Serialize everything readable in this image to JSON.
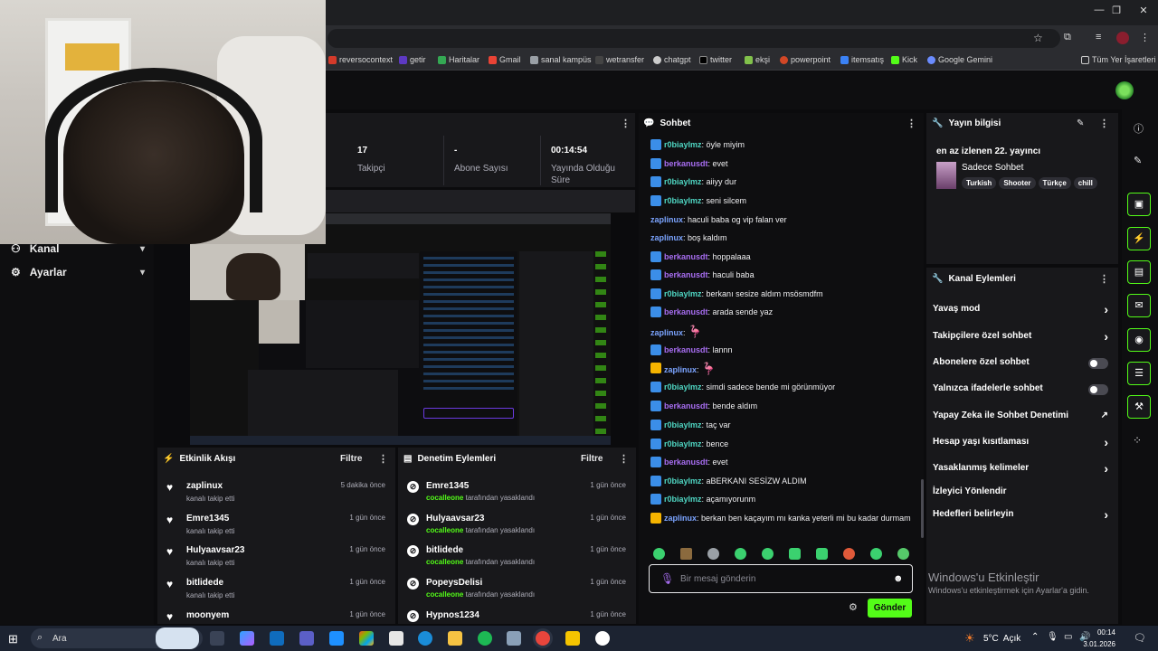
{
  "browser": {
    "window_controls": [
      "—",
      "❐",
      "✕"
    ],
    "bookmarks": [
      "reversocontext",
      "getir",
      "Haritalar",
      "Gmail",
      "sanal kampüs",
      "wetransfer",
      "chatgpt",
      "twitter",
      "ekşi",
      "powerpoint",
      "itemsatış",
      "Kick",
      "Google Gemini"
    ],
    "all_bookmarks": "Tüm Yer İşaretleri"
  },
  "sidebar": {
    "items": [
      {
        "label": "Kanal"
      },
      {
        "label": "Ayarlar"
      }
    ]
  },
  "stats": {
    "followers": {
      "value": "17",
      "label": "Takipçi"
    },
    "subs": {
      "value": "-",
      "label": "Abone Sayısı"
    },
    "uptime": {
      "value": "00:14:54",
      "label": "Yayında Olduğu Süre"
    }
  },
  "activity": {
    "title": "Etkinlik Akışı",
    "filter": "Filtre",
    "items": [
      {
        "name": "zaplinux",
        "sub": "kanalı takip etti",
        "time": "5 dakika önce"
      },
      {
        "name": "Emre1345",
        "sub": "kanalı takip etti",
        "time": "1 gün önce"
      },
      {
        "name": "Hulyaavsar23",
        "sub": "kanalı takip etti",
        "time": "1 gün önce"
      },
      {
        "name": "bitlidede",
        "sub": "kanalı takip etti",
        "time": "1 gün önce"
      },
      {
        "name": "moonyem",
        "sub": "",
        "time": "1 gün önce"
      }
    ]
  },
  "moderation": {
    "title": "Denetim Eylemleri",
    "filter": "Filtre",
    "items": [
      {
        "name": "Emre1345",
        "by": "cocalleone",
        "sub": "tarafından yasaklandı",
        "time": "1 gün önce"
      },
      {
        "name": "Hulyaavsar23",
        "by": "cocalleone",
        "sub": "tarafından yasaklandı",
        "time": "1 gün önce"
      },
      {
        "name": "bitlidede",
        "by": "cocalleone",
        "sub": "tarafından yasaklandı",
        "time": "1 gün önce"
      },
      {
        "name": "PopeysDelisi",
        "by": "cocalleone",
        "sub": "tarafından yasaklandı",
        "time": "1 gün önce"
      },
      {
        "name": "Hypnos1234",
        "by": "",
        "sub": "",
        "time": "1 gün önce"
      }
    ]
  },
  "chat": {
    "title": "Sohbet",
    "messages": [
      {
        "badge": "blue",
        "user": "r0biaylmz",
        "color": "g",
        "text": "öyle miyim"
      },
      {
        "badge": "blue",
        "user": "berkanusdt",
        "color": "p",
        "text": "evet"
      },
      {
        "badge": "blue",
        "user": "r0biaylmz",
        "color": "g",
        "text": "aiiyy dur"
      },
      {
        "badge": "blue",
        "user": "r0biaylmz",
        "color": "g",
        "text": "seni silcem"
      },
      {
        "badge": "",
        "user": "zaplinux",
        "color": "b",
        "text": "haculi baba og vip falan ver"
      },
      {
        "badge": "",
        "user": "zaplinux",
        "color": "b",
        "text": "boş kaldım"
      },
      {
        "badge": "blue",
        "user": "berkanusdt",
        "color": "p",
        "text": "hoppalaaa"
      },
      {
        "badge": "blue",
        "user": "berkanusdt",
        "color": "p",
        "text": "haculi baba"
      },
      {
        "badge": "blue",
        "user": "r0biaylmz",
        "color": "g",
        "text": "berkanı sesize aldım msösmdfm"
      },
      {
        "badge": "blue",
        "user": "berkanusdt",
        "color": "p",
        "text": "arada sende yaz"
      },
      {
        "badge": "",
        "user": "zaplinux",
        "color": "b",
        "text": "",
        "emote": true
      },
      {
        "badge": "blue",
        "user": "berkanusdt",
        "color": "p",
        "text": "lannn"
      },
      {
        "badge": "gold",
        "user": "zaplinux",
        "color": "b",
        "text": "",
        "emote": true
      },
      {
        "badge": "blue",
        "user": "r0biaylmz",
        "color": "g",
        "text": "simdi sadece bende mi görünmüyor"
      },
      {
        "badge": "blue",
        "user": "berkanusdt",
        "color": "p",
        "text": "bende aldım"
      },
      {
        "badge": "blue",
        "user": "r0biaylmz",
        "color": "g",
        "text": "taç var"
      },
      {
        "badge": "blue",
        "user": "r0biaylmz",
        "color": "g",
        "text": "bence"
      },
      {
        "badge": "blue",
        "user": "berkanusdt",
        "color": "p",
        "text": "evet"
      },
      {
        "badge": "blue",
        "user": "r0biaylmz",
        "color": "g",
        "text": "aBERKANI SESİZW ALDIM"
      },
      {
        "badge": "blue",
        "user": "r0biaylmz",
        "color": "g",
        "text": "açamıyorunm"
      },
      {
        "badge": "gold",
        "user": "zaplinux",
        "color": "b",
        "text": "berkan ben kaçayım mı kanka yeterli mi bu kadar durmam"
      }
    ],
    "placeholder": "Bir mesaj gönderin",
    "send": "Gönder"
  },
  "stream_info": {
    "title": "Yayın bilgisi",
    "rank": "en az izlenen 22. yayıncı",
    "category": "Sadece Sohbet",
    "tags": [
      "Turkish",
      "Shooter",
      "Türkçe",
      "chill"
    ]
  },
  "channel_actions": {
    "title": "Kanal Eylemleri",
    "items": [
      {
        "label": "Yavaş mod",
        "kind": "chev"
      },
      {
        "label": "Takipçilere özel sohbet",
        "kind": "chev"
      },
      {
        "label": "Abonelere özel sohbet",
        "kind": "toggle"
      },
      {
        "label": "Yalnızca ifadelerle sohbet",
        "kind": "toggle"
      },
      {
        "label": "Yapay Zeka ile Sohbet Denetimi",
        "kind": "ext"
      },
      {
        "label": "Hesap yaşı kısıtlaması",
        "kind": "chev"
      },
      {
        "label": "Yasaklanmış kelimeler",
        "kind": "chev"
      },
      {
        "label": "İzleyici Yönlendir",
        "kind": "none"
      },
      {
        "label": "Hedefleri belirleyin",
        "kind": "chev"
      }
    ]
  },
  "windows": {
    "activate_title": "Windows'u Etkinleştir",
    "activate_sub": "Windows'u etkinleştirmek için Ayarlar'a gidin.",
    "search": "Ara",
    "weather": "5°C  Açık",
    "time": "00:14",
    "date": "3.01.2026"
  }
}
